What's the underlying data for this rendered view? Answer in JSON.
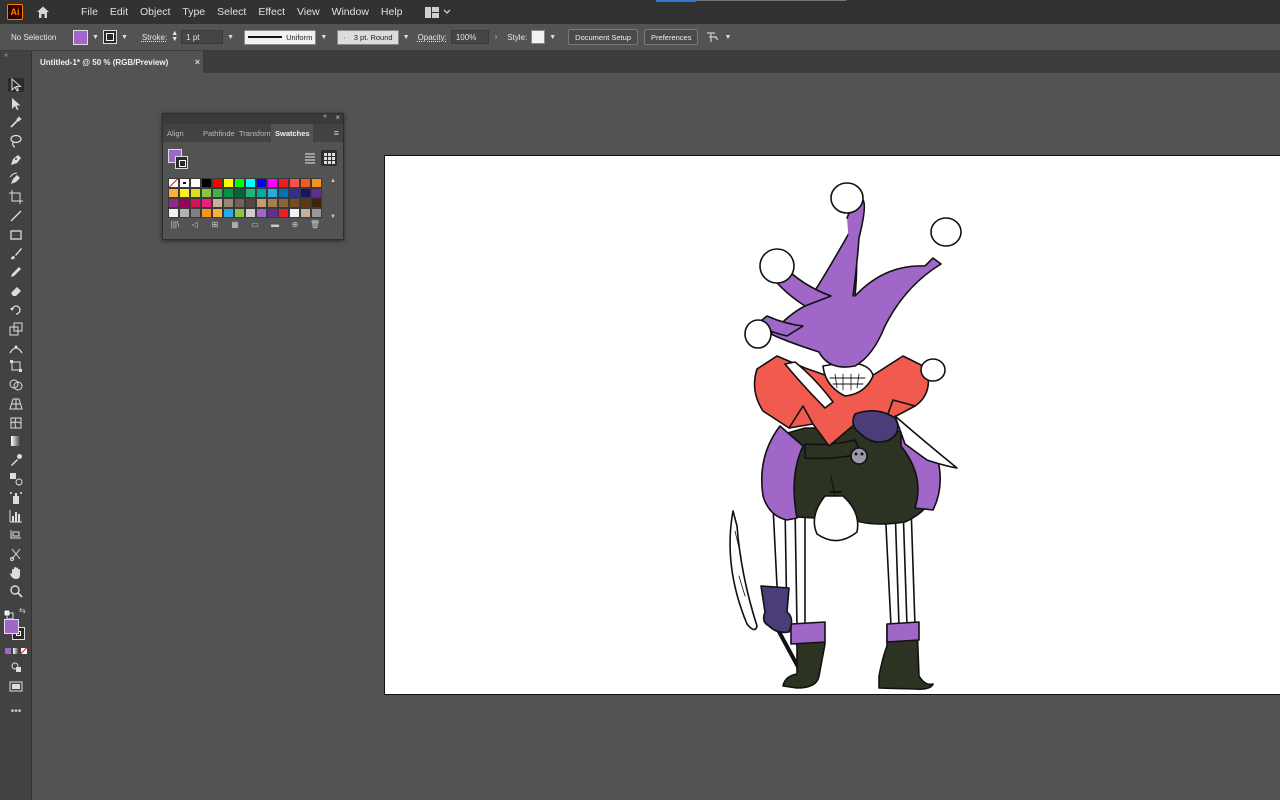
{
  "app": {
    "logo_text": "Ai",
    "accent": "#ff7c00"
  },
  "menu": {
    "items": [
      "File",
      "Edit",
      "Object",
      "Type",
      "Select",
      "Effect",
      "View",
      "Window",
      "Help"
    ]
  },
  "control_bar": {
    "selection_label": "No Selection",
    "fill_color": "#a066c8",
    "stroke_label": "Stroke:",
    "stroke_weight": "1 pt",
    "profile_label": "Uniform",
    "brush_label": "3 pt. Round",
    "opacity_label": "Opacity:",
    "opacity_value": "100%",
    "style_label": "Style:",
    "document_setup": "Document Setup",
    "preferences": "Preferences"
  },
  "document_tab": {
    "title": "Untitled-1* @ 50 % (RGB/Preview)",
    "close": "×"
  },
  "swatches_panel": {
    "tabs": [
      "Align",
      "Pathfinder",
      "Transform",
      "Swatches"
    ],
    "active_tab": "Swatches",
    "fill_color": "#a066c8",
    "swatches": [
      "none",
      "registration",
      "#ffffff",
      "#000000",
      "#ff0000",
      "#ffff00",
      "#00ff00",
      "#00ffff",
      "#0000ff",
      "#ff00ff",
      "#ed1c24",
      "#ff4f4f",
      "#f15a24",
      "#f7931e",
      "#fbb03b",
      "#fcee21",
      "#d9e021",
      "#8cc63f",
      "#39b54a",
      "#009245",
      "#006837",
      "#22b573",
      "#00a99d",
      "#29abe2",
      "#0071bc",
      "#2e3192",
      "#1b1464",
      "#662d91",
      "#93278f",
      "#9e005d",
      "#d4145a",
      "#ed1e79",
      "#c7b299",
      "#998675",
      "#736357",
      "#534741",
      "#c69c6d",
      "#a67c52",
      "#8c6239",
      "#754c24",
      "#603813",
      "#42210b",
      "#f2f2f2",
      "#b3b3b3",
      "#808080",
      "#f7931e",
      "#fbb03b",
      "#29abe2",
      "#8cc63f",
      "#cccccc",
      "#a066c8",
      "#662d91",
      "#ed1c24",
      "#f2f2f2",
      "#c7b299",
      "#999999"
    ]
  },
  "artwork": {
    "subject": "jester skeleton illustration",
    "colors": {
      "hat": "#a066c8",
      "collar": "#f05a4f",
      "dark": "#2c3322",
      "glove": "#4b3d7a",
      "outline": "#111111"
    }
  }
}
